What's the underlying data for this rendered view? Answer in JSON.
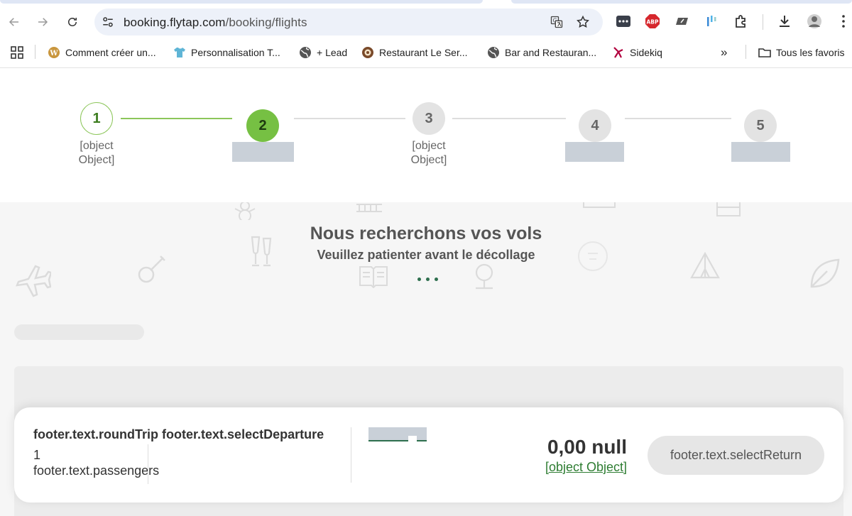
{
  "browser": {
    "url_host": "booking.flytap.com",
    "url_path": "/booking/flights",
    "bookmarks": [
      {
        "label": "Comment créer un...",
        "icon": "wordpress-icon"
      },
      {
        "label": "Personnalisation T...",
        "icon": "tshirt-icon"
      },
      {
        "label": "+ Lead",
        "icon": "globe-icon"
      },
      {
        "label": "Restaurant Le Ser...",
        "icon": "restaurant-icon"
      },
      {
        "label": "Bar and Restauran...",
        "icon": "globe-icon"
      },
      {
        "label": "Sidekiq",
        "icon": "sidekiq-icon"
      }
    ],
    "bookmarks_more": "»",
    "all_bookmarks": "Tous les favoris",
    "extension_abp": "ABP"
  },
  "stepper": {
    "steps": [
      {
        "number": "1",
        "label": "[object Object]",
        "state": "done"
      },
      {
        "number": "2",
        "label": "",
        "state": "active"
      },
      {
        "number": "3",
        "label": "[object Object]",
        "state": "todo"
      },
      {
        "number": "4",
        "label": "",
        "state": "todo"
      },
      {
        "number": "5",
        "label": "",
        "state": "todo"
      }
    ]
  },
  "loader": {
    "title": "Nous recherchons vos vols",
    "subtitle": "Veuillez patienter avant le décollage"
  },
  "footer": {
    "trip_type": "footer.text.roundTrip",
    "select_departure": "footer.text.selectDeparture",
    "passenger_count": "1",
    "passengers_label": "footer.text.passengers",
    "price": "0,00 null",
    "price_link": "[object Object]",
    "action_button": "footer.text.selectReturn"
  },
  "colors": {
    "accent_green": "#76c043",
    "dark_green": "#2e6f4e",
    "placeholder_grey": "#c9d0d8"
  }
}
